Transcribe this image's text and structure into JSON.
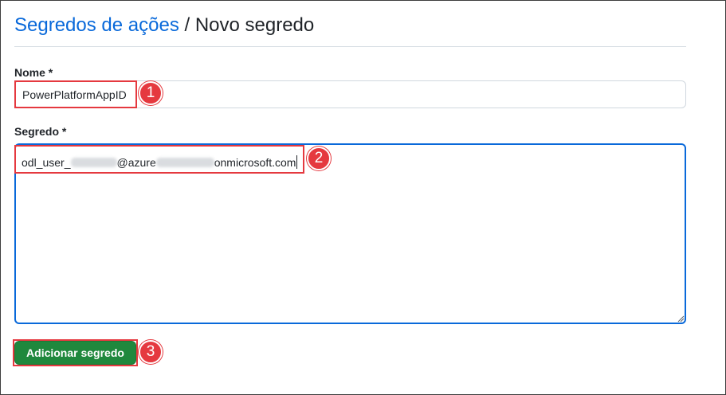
{
  "header": {
    "breadcrumb_link": "Segredos de ações",
    "separator": " / ",
    "current": "Novo segredo"
  },
  "form": {
    "name_label": "Nome *",
    "name_value": "PowerPlatformAppID",
    "secret_label": "Segredo *",
    "secret_value": {
      "part1": "odl_user_",
      "part2": "@azure",
      "part3": "onmicrosoft.com"
    },
    "submit_label": "Adicionar segredo"
  },
  "annotations": {
    "step1": "1",
    "step2": "2",
    "step3": "3"
  },
  "colors": {
    "link": "#0969da",
    "primary_button": "#1f883d",
    "annotation": "#e5393f",
    "focus_border": "#0969da"
  }
}
